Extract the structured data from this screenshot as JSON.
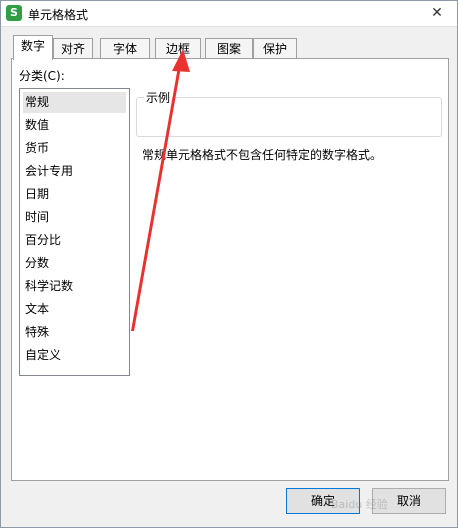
{
  "window": {
    "title": "单元格格式",
    "close_glyph": "✕",
    "app_icon_letter": "S"
  },
  "tabs": [
    {
      "label": "数字",
      "active": true
    },
    {
      "label": "对齐"
    },
    {
      "label": "字体"
    },
    {
      "label": "边框"
    },
    {
      "label": "图案"
    },
    {
      "label": "保护"
    }
  ],
  "category": {
    "label": "分类(C):",
    "items": [
      "常规",
      "数值",
      "货币",
      "会计专用",
      "日期",
      "时间",
      "百分比",
      "分数",
      "科学记数",
      "文本",
      "特殊",
      "自定义"
    ],
    "selected": "常规"
  },
  "sample": {
    "label": "示例",
    "value": ""
  },
  "description": "常规单元格格式不包含任何特定的数字格式。",
  "buttons": {
    "ok": "确定",
    "cancel": "取消"
  },
  "annotation": {
    "arrow_color": "#e8322f"
  },
  "watermark": "Baidu 经验"
}
